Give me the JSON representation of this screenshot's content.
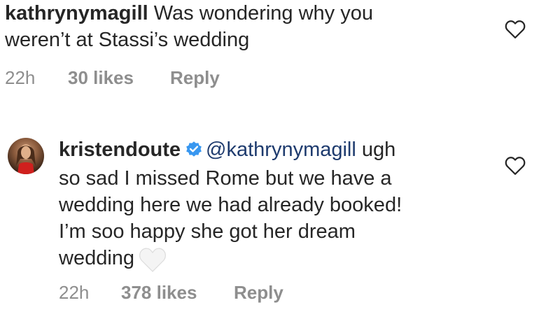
{
  "comments": [
    {
      "username": "kathrynymagill",
      "text_line1": "Was wondering why you",
      "text_line2": "weren’t at Stassi’s wedding",
      "time": "22h",
      "likes": "30 likes",
      "reply": "Reply",
      "avatar_icon": "none"
    },
    {
      "username": "kristendoute",
      "verified_icon": "verified-badge-icon",
      "mention": "@kathrynymagill",
      "text_line1_after_mention": " ugh",
      "text_line2": "so sad I missed Rome but we have a",
      "text_line3": "wedding here we had already booked!",
      "text_line4": "I’m soo happy she got her dream",
      "text_line5": "wedding",
      "emoji_icon": "white-heart-emoji-icon",
      "time": "22h",
      "likes": "378 likes",
      "reply": "Reply"
    }
  ],
  "colors": {
    "text": "#262626",
    "meta": "#8e8e8e",
    "mention": "#1e3b6e",
    "verified": "#3897f0"
  }
}
